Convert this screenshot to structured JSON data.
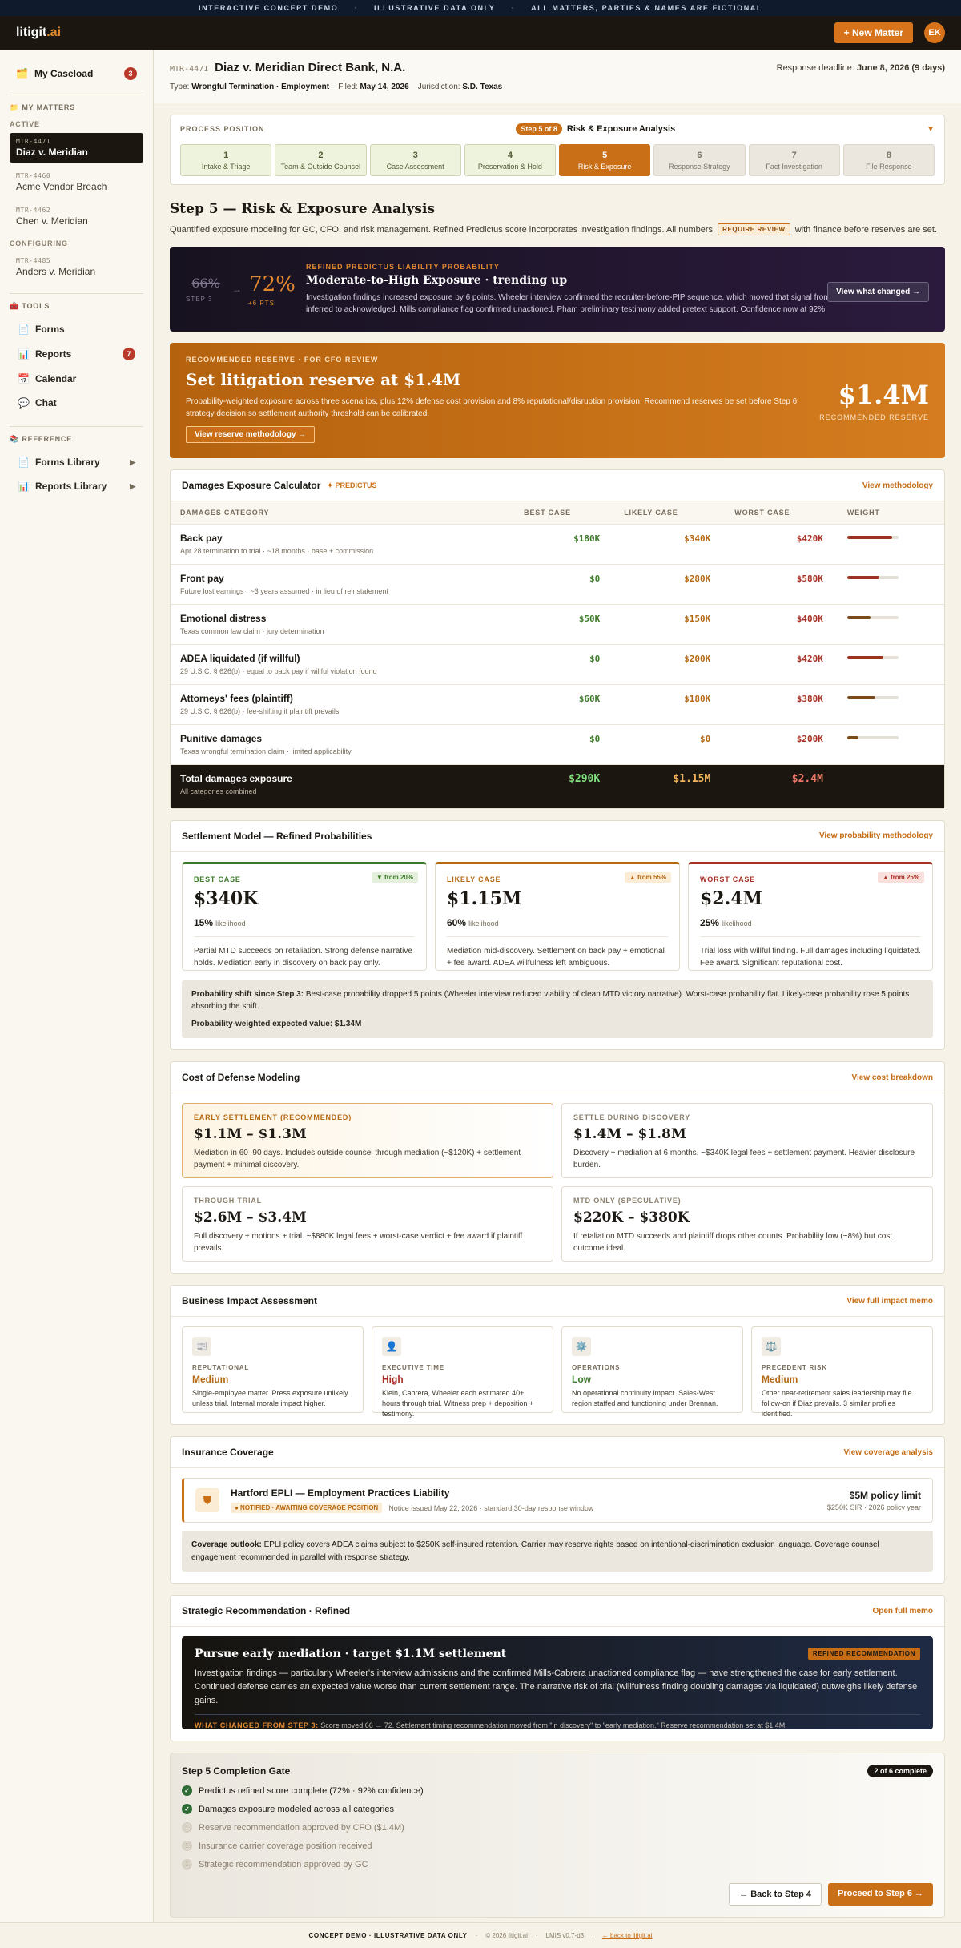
{
  "banner": {
    "a": "INTERACTIVE CONCEPT DEMO",
    "b": "ILLUSTRATIVE DATA ONLY",
    "c": "ALL MATTERS, PARTIES & NAMES ARE FICTIONAL"
  },
  "topbar": {
    "logo_main": "litigit",
    "logo_ext": ".ai",
    "new_matter": "+ New Matter",
    "avatar": "EK"
  },
  "sidebar": {
    "caseload": "My Caseload",
    "caseload_count": "3",
    "my_matters": "MY MATTERS",
    "active": "ACTIVE",
    "configuring": "CONFIGURING",
    "active_matters": [
      {
        "id": "MTR-4471",
        "name": "Diaz v. Meridian"
      },
      {
        "id": "MTR-4460",
        "name": "Acme Vendor Breach"
      },
      {
        "id": "MTR-4462",
        "name": "Chen v. Meridian"
      }
    ],
    "config_matters": [
      {
        "id": "MTR-4485",
        "name": "Anders v. Meridian"
      }
    ],
    "tools": "TOOLS",
    "forms": "Forms",
    "reports": "Reports",
    "reports_count": "7",
    "calendar": "Calendar",
    "chat": "Chat",
    "reference": "REFERENCE",
    "forms_library": "Forms Library",
    "reports_library": "Reports Library"
  },
  "matter": {
    "id": "MTR-4471",
    "title": "Diaz v. Meridian Direct Bank, N.A.",
    "deadline_label": "Response deadline:",
    "deadline": "June 8, 2026 (9 days)",
    "type_label": "Type:",
    "type": "Wrongful Termination · Employment",
    "filed_label": "Filed:",
    "filed": "May 14, 2026",
    "jur_label": "Jurisdiction:",
    "jur": "S.D. Texas"
  },
  "process": {
    "label": "PROCESS POSITION",
    "pill": "Step 5 of 8",
    "current": "Risk & Exposure Analysis",
    "steps": [
      {
        "n": "1",
        "label": "Intake & Triage"
      },
      {
        "n": "2",
        "label": "Team & Outside Counsel"
      },
      {
        "n": "3",
        "label": "Case Assessment"
      },
      {
        "n": "4",
        "label": "Preservation & Hold"
      },
      {
        "n": "5",
        "label": "Risk & Exposure"
      },
      {
        "n": "6",
        "label": "Response Strategy"
      },
      {
        "n": "7",
        "label": "Fact Investigation"
      },
      {
        "n": "8",
        "label": "File Response"
      }
    ]
  },
  "page": {
    "title": "Step 5 — Risk & Exposure Analysis",
    "desc_a": "Quantified exposure modeling for GC, CFO, and risk management. Refined Predictus score incorporates investigation findings. All numbers",
    "desc_tag": "REQUIRE REVIEW",
    "desc_b": "with finance before reserves are set."
  },
  "score": {
    "old": "66%",
    "old_label": "STEP 3",
    "arrow": "→",
    "new": "72%",
    "pts": "+6 PTS",
    "label": "REFINED PREDICTUS LIABILITY PROBABILITY",
    "title": "Moderate-to-High Exposure · trending up",
    "text": "Investigation findings increased exposure by 6 points. Wheeler interview confirmed the recruiter-before-PIP sequence, which moved that signal from inferred to acknowledged. Mills compliance flag confirmed unactioned. Pham preliminary testimony added pretext support. Confidence now at 92%.",
    "button": "View what changed →"
  },
  "reserve": {
    "label": "RECOMMENDED RESERVE · FOR CFO REVIEW",
    "title": "Set litigation reserve at $1.4M",
    "text": "Probability-weighted exposure across three scenarios, plus 12% defense cost provision and 8% reputational/disruption provision. Recommend reserves be set before Step 6 strategy decision so settlement authority threshold can be calibrated.",
    "button": "View reserve methodology →",
    "amount": "$1.4M",
    "amount_label": "RECOMMENDED RESERVE"
  },
  "damages": {
    "title": "Damages Exposure Calculator",
    "star": "✦",
    "predictus": "PREDICTUS",
    "link": "View methodology",
    "cols": [
      "DAMAGES CATEGORY",
      "BEST CASE",
      "LIKELY CASE",
      "WORST CASE",
      "WEIGHT"
    ],
    "rows": [
      {
        "cat": "Back pay",
        "desc": "Apr 28 termination to trial · ~18 months · base + commission",
        "best": "$180K",
        "likely": "$340K",
        "worst": "$420K",
        "weight": 0.88
      },
      {
        "cat": "Front pay",
        "desc": "Future lost earnings · ~3 years assumed · in lieu of reinstatement",
        "best": "$0",
        "likely": "$280K",
        "worst": "$580K",
        "weight": 0.62
      },
      {
        "cat": "Emotional distress",
        "desc": "Texas common law claim · jury determination",
        "best": "$50K",
        "likely": "$150K",
        "worst": "$400K",
        "weight": 0.45
      },
      {
        "cat": "ADEA liquidated (if willful)",
        "desc": "29 U.S.C. § 626(b) · equal to back pay if willful violation found",
        "best": "$0",
        "likely": "$200K",
        "worst": "$420K",
        "weight": 0.7
      },
      {
        "cat": "Attorneys' fees (plaintiff)",
        "desc": "29 U.S.C. § 626(b) · fee-shifting if plaintiff prevails",
        "best": "$60K",
        "likely": "$180K",
        "worst": "$380K",
        "weight": 0.55
      },
      {
        "cat": "Punitive damages",
        "desc": "Texas wrongful termination claim · limited applicability",
        "best": "$0",
        "likely": "$0",
        "worst": "$200K",
        "weight": 0.22
      }
    ],
    "total": {
      "cat": "Total damages exposure",
      "desc": "All categories combined",
      "best": "$290K",
      "likely": "$1.15M",
      "worst": "$2.4M"
    }
  },
  "settlement": {
    "title": "Settlement Model — Refined Probabilities",
    "link": "View probability methodology",
    "boxes": [
      {
        "label": "BEST CASE",
        "change": "▼ from 20%",
        "amount": "$340K",
        "pct": "15%",
        "pct_label": "likelihood",
        "text": "Partial MTD succeeds on retaliation. Strong defense narrative holds. Mediation early in discovery on back pay only."
      },
      {
        "label": "LIKELY CASE",
        "change": "▲ from 55%",
        "amount": "$1.15M",
        "pct": "60%",
        "pct_label": "likelihood",
        "text": "Mediation mid-discovery. Settlement on back pay + emotional + fee award. ADEA willfulness left ambiguous."
      },
      {
        "label": "WORST CASE",
        "change": "▲ from 25%",
        "amount": "$2.4M",
        "pct": "25%",
        "pct_label": "likelihood",
        "text": "Trial loss with willful finding. Full damages including liquidated. Fee award. Significant reputational cost."
      }
    ],
    "shift_label": "Probability shift since Step 3:",
    "shift_text": "Best-case probability dropped 5 points (Wheeler interview reduced viability of clean MTD victory narrative). Worst-case probability flat. Likely-case probability rose 5 points absorbing the shift.",
    "ev": "Probability-weighted expected value: $1.34M"
  },
  "defense": {
    "title": "Cost of Defense Modeling",
    "link": "View cost breakdown",
    "boxes": [
      {
        "label": "EARLY SETTLEMENT (RECOMMENDED)",
        "amount": "$1.1M – $1.3M",
        "text": "Mediation in 60–90 days. Includes outside counsel through mediation (~$120K) + settlement payment + minimal discovery."
      },
      {
        "label": "SETTLE DURING DISCOVERY",
        "amount": "$1.4M – $1.8M",
        "text": "Discovery + mediation at 6 months. ~$340K legal fees + settlement payment. Heavier disclosure burden."
      },
      {
        "label": "THROUGH TRIAL",
        "amount": "$2.6M – $3.4M",
        "text": "Full discovery + motions + trial. ~$880K legal fees + worst-case verdict + fee award if plaintiff prevails."
      },
      {
        "label": "MTD ONLY (SPECULATIVE)",
        "amount": "$220K – $380K",
        "text": "If retaliation MTD succeeds and plaintiff drops other counts. Probability low (~8%) but cost outcome ideal."
      }
    ]
  },
  "impact": {
    "title": "Business Impact Assessment",
    "link": "View full impact memo",
    "boxes": [
      {
        "icon": "📰",
        "label": "REPUTATIONAL",
        "level": "Medium",
        "text": "Single-employee matter. Press exposure unlikely unless trial. Internal morale impact higher."
      },
      {
        "icon": "👤",
        "label": "EXECUTIVE TIME",
        "level": "High",
        "text": "Klein, Cabrera, Wheeler each estimated 40+ hours through trial. Witness prep + deposition + testimony."
      },
      {
        "icon": "⚙️",
        "label": "OPERATIONS",
        "level": "Low",
        "text": "No operational continuity impact. Sales-West region staffed and functioning under Brennan."
      },
      {
        "icon": "⚖️",
        "label": "PRECEDENT RISK",
        "level": "Medium",
        "text": "Other near-retirement sales leadership may file follow-on if Diaz prevails. 3 similar profiles identified."
      }
    ]
  },
  "insurance": {
    "title": "Insurance Coverage",
    "link": "View coverage analysis",
    "policy": "Hartford EPLI — Employment Practices Liability",
    "tag": "● NOTIFIED · AWAITING COVERAGE POSITION",
    "notice": "Notice issued May 22, 2026 · standard 30-day response window",
    "limit": "$5M policy limit",
    "sir": "$250K SIR · 2026 policy year",
    "outlook_label": "Coverage outlook:",
    "outlook": "EPLI policy covers ADEA claims subject to $250K self-insured retention. Carrier may reserve rights based on intentional-discrimination exclusion language. Coverage counsel engagement recommended in parallel with response strategy."
  },
  "strategy": {
    "title": "Strategic Recommendation · Refined",
    "link": "Open full memo",
    "headline": "Pursue early mediation · target $1.1M settlement",
    "tag": "REFINED RECOMMENDATION",
    "text": "Investigation findings — particularly Wheeler's interview admissions and the confirmed Mills-Cabrera unactioned compliance flag — have strengthened the case for early settlement. Continued defense carries an expected value worse than current settlement range. The narrative risk of trial (willfulness finding doubling damages via liquidated) outweighs likely defense gains.",
    "wc_label": "WHAT CHANGED FROM STEP 3:",
    "wc_text": "Score moved 66 → 72. Settlement timing recommendation moved from \"in discovery\" to \"early mediation.\" Reserve recommendation set at $1.4M."
  },
  "gate": {
    "title": "Step 5 Completion Gate",
    "badge": "2 of 6 complete",
    "items": [
      {
        "text": "Predictus refined score complete (72% · 92% confidence)",
        "done": true
      },
      {
        "text": "Damages exposure modeled across all categories",
        "done": true
      },
      {
        "text": "Reserve recommendation approved by CFO ($1.4M)",
        "done": false
      },
      {
        "text": "Insurance carrier coverage position received",
        "done": false
      },
      {
        "text": "Strategic recommendation approved by GC",
        "done": false
      }
    ],
    "back": "← Back to Step 4",
    "next": "Proceed to Step 6 →"
  },
  "footer": {
    "a": "CONCEPT DEMO · ILLUSTRATIVE DATA ONLY",
    "b": "© 2026 litigit.ai",
    "c": "LMIS v0.7-d3",
    "d": "← back to litigit.ai"
  },
  "colors": {
    "accent": "#c96f17",
    "best": "#3c7a2a",
    "likely": "#b56812",
    "worst": "#a72f23"
  }
}
